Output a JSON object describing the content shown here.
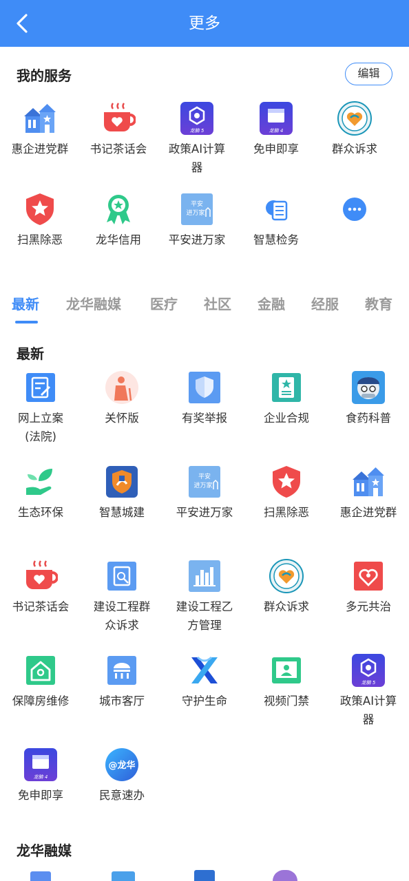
{
  "header": {
    "title": "更多"
  },
  "my_services": {
    "title": "我的服务",
    "edit_label": "编辑",
    "items": [
      {
        "label": "惠企进党群",
        "icon": "buildings-icon"
      },
      {
        "label": "书记茶话会",
        "icon": "teacup-icon"
      },
      {
        "label": "政策AI计算器",
        "icon": "longnao5-icon"
      },
      {
        "label": "免申即享",
        "icon": "longnao4-icon"
      },
      {
        "label": "群众诉求",
        "icon": "emblem-icon"
      },
      {
        "label": "扫黑除恶",
        "icon": "shield-star-icon"
      },
      {
        "label": "龙华信用",
        "icon": "medal-icon"
      },
      {
        "label": "平安进万家",
        "icon": "ping-an-icon"
      },
      {
        "label": "智慧检务",
        "icon": "document-icon"
      },
      {
        "label": "",
        "icon": "more-icon"
      }
    ]
  },
  "tabs": [
    {
      "label": "最新",
      "active": true
    },
    {
      "label": "龙华融媒"
    },
    {
      "label": "医疗"
    },
    {
      "label": "社区"
    },
    {
      "label": "金融"
    },
    {
      "label": "经服"
    },
    {
      "label": "教育"
    }
  ],
  "latest": {
    "title": "最新",
    "items": [
      {
        "label": "网上立案(法院)",
        "icon": "filing-icon"
      },
      {
        "label": "关怀版",
        "icon": "elder-icon"
      },
      {
        "label": "有奖举报",
        "icon": "report-shield-icon"
      },
      {
        "label": "企业合规",
        "icon": "compliance-icon"
      },
      {
        "label": "食药科普",
        "icon": "mascot-icon"
      },
      {
        "label": "生态环保",
        "icon": "leaf-hand-icon"
      },
      {
        "label": "智慧城建",
        "icon": "city-badge-icon"
      },
      {
        "label": "平安进万家",
        "icon": "ping-an-icon"
      },
      {
        "label": "扫黑除恶",
        "icon": "shield-star-icon"
      },
      {
        "label": "惠企进党群",
        "icon": "buildings-icon"
      },
      {
        "label": "书记茶话会",
        "icon": "teacup-icon"
      },
      {
        "label": "建设工程群众诉求",
        "icon": "construction-icon"
      },
      {
        "label": "建设工程乙方管理",
        "icon": "chart-building-icon"
      },
      {
        "label": "群众诉求",
        "icon": "emblem-icon"
      },
      {
        "label": "多元共治",
        "icon": "heart-people-icon"
      },
      {
        "label": "保障房维修",
        "icon": "house-icon"
      },
      {
        "label": "城市客厅",
        "icon": "city-hall-icon"
      },
      {
        "label": "守护生命",
        "icon": "x-logo-icon"
      },
      {
        "label": "视频门禁",
        "icon": "video-door-icon"
      },
      {
        "label": "政策AI计算器",
        "icon": "longnao5-icon"
      },
      {
        "label": "免申即享",
        "icon": "longnao4-icon"
      },
      {
        "label": "民意速办",
        "icon": "longhua-icon"
      }
    ]
  },
  "media_section": {
    "title": "龙华融媒"
  },
  "icon_texts": {
    "longnao5": "龙脑 5",
    "longnao4": "龙脑 4",
    "pingan": "平安\n进万家",
    "longhua": "@龙华"
  },
  "colors": {
    "primary": "#3f8cf7",
    "red": "#ef4b4b",
    "green": "#2fc98a"
  }
}
